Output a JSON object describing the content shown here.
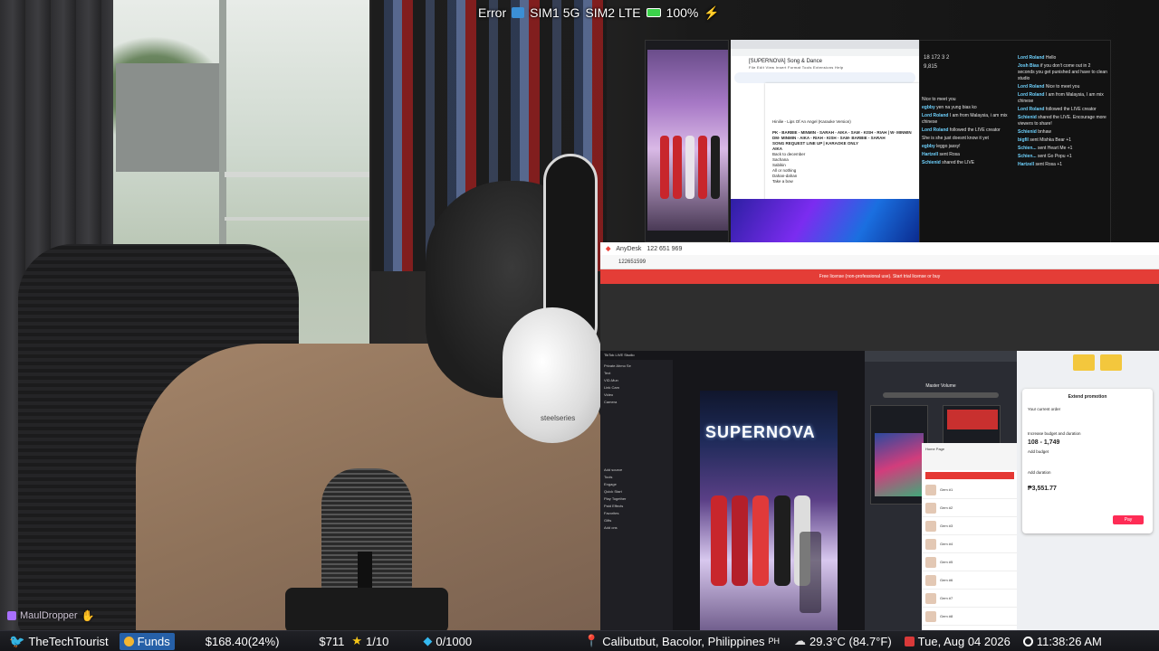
{
  "status_bar": {
    "error": "Error",
    "sim1": "SIM1 5G",
    "sim2": "SIM2 LTE",
    "battery": "100%"
  },
  "docs": {
    "title": "[SUPERNOVA] Song & Dance",
    "menu": "File  Edit  View  Insert  Format  Tools  Extensions  Help",
    "lines": [
      "Hinilie - Lips Of An Angel (Karaoke Version)",
      "PK - BARBIE - MINMIN - SARAH - AIKA - SAM - KISH - RIAH | W- MINMIN",
      "DM- MINMIN - AIKA - RIAH - KISH - SAM- BARBIE - SARAH",
      "SONG REQUEST LINE UP | KARAOKE ONLY",
      "AIKA",
      "Back to december",
      "Sachana",
      "Sabikin",
      "All or nothing",
      "Dahan-dahan",
      "Take a bow"
    ]
  },
  "chat": {
    "stats": "18   172   3   2",
    "likes": "9,815",
    "left": [
      {
        "user": "",
        "text": "Nice to meet you"
      },
      {
        "user": "egbby",
        "text": "yen na yung bias ko"
      },
      {
        "user": "Lord Roland",
        "text": "I am from Malaysia, i am mix chinese"
      },
      {
        "user": "Lord Roland",
        "text": "followed the LIVE creator"
      },
      {
        "user": "",
        "text": "She is she just doesnt know it yet"
      },
      {
        "user": "egbby",
        "text": "leggo jassy!"
      },
      {
        "user": "Hartzell",
        "text": "sent Rosa"
      },
      {
        "user": "Schienid",
        "text": "shared the LIVE"
      }
    ],
    "right": [
      {
        "user": "Lord Roland",
        "text": "Hello"
      },
      {
        "user": "Josh Bias",
        "text": "if you don't come out in 2 seconds you get punished and have to clean studio"
      },
      {
        "user": "Lord Roland",
        "text": "Nice to meet you"
      },
      {
        "user": "Lord Roland",
        "text": "I am from Malaysia, I am mix chinese"
      },
      {
        "user": "Lord Roland",
        "text": "followed the LIVE creator"
      },
      {
        "user": "Schienid",
        "text": "shared the LIVE. Encourage more viewers to share!"
      },
      {
        "user": "Schienid",
        "text": "bnhaw"
      },
      {
        "user": "bigfil",
        "text": "sent Mishka Bear +1"
      },
      {
        "user": "Schien...",
        "text": "sent Heart Me +1"
      },
      {
        "user": "Schien...",
        "text": "sent Go Popu +1"
      },
      {
        "user": "Hartzell",
        "text": "sent Rosa +1"
      }
    ]
  },
  "anydesk": {
    "app": "AnyDesk",
    "tab_id": "122 651 969",
    "address": "122651599",
    "banner": "Free license (non-professional use). Start trial license or buy"
  },
  "studio": {
    "title": "TikTok LIVE Studio",
    "sidebar": [
      "Private Ahmo Se",
      "Text",
      "VID-Mun",
      "Link Cam",
      "Video",
      "Camera",
      "Add source",
      "Tools",
      "Engage",
      "Quick Start",
      "Play Together",
      "Paid Effects",
      "Favorites",
      "Gifts",
      "Add ons"
    ],
    "logo": "SUPERNOVA"
  },
  "obs": {
    "title": "Master Volume"
  },
  "shop": {
    "tab": "Home Page",
    "rows": [
      "Gem #1",
      "Gem #2",
      "Gem #3",
      "Gem #4",
      "Gem #5",
      "Gem #6",
      "Gem #7",
      "Gem #8"
    ]
  },
  "promo": {
    "title": "Extend promotion",
    "current": "Your current order",
    "increase": "Increase budget and duration",
    "range": "108 - 1,749",
    "add_budget": "Add budget",
    "add_duration": "Add duration",
    "total": "₱3,551.77",
    "pay": "Pay"
  },
  "overlay": {
    "drop_user": "MaulDropper"
  },
  "ticker": {
    "handle": "TheTechTourist",
    "funds_label": "Funds",
    "funds_value": "$168.40(24%)",
    "goal": "$711",
    "stars": "1/10",
    "diamonds": "0/1000",
    "location": "Calibutbut, Bacolor, Philippines",
    "country": "PH",
    "weather": "29.3°C (84.7°F)",
    "date": "Tue, Aug 04 2026",
    "time": "11:38:26 AM"
  }
}
